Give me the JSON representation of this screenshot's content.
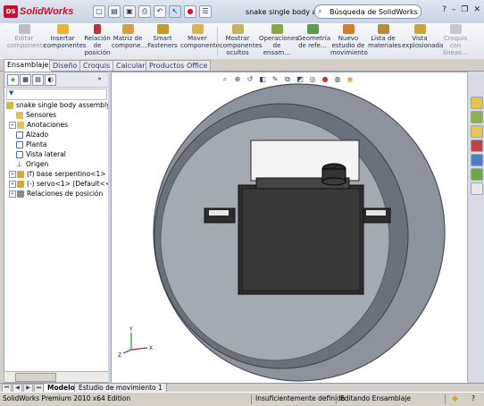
{
  "app": {
    "logo_letters": "DS",
    "name": "SolidWorks",
    "brand_color": "#c8102e"
  },
  "title": {
    "document": "snake single body asse…",
    "search_placeholder": "Búsqueda de SolidWorks",
    "help": "?"
  },
  "ribbon": {
    "buttons": [
      {
        "label": "Editar componente",
        "icon": "edit-component-icon",
        "disabled": true
      },
      {
        "label": "Insertar componentes",
        "icon": "insert-components-icon",
        "disabled": false
      },
      {
        "label": "Relación de posición",
        "icon": "mate-icon",
        "disabled": false
      },
      {
        "label": "Matriz de compone…",
        "icon": "component-pattern-icon",
        "disabled": false
      },
      {
        "label": "Smart Fasteners",
        "icon": "smart-fasteners-icon",
        "disabled": false
      },
      {
        "label": "Mover componente",
        "icon": "move-component-icon",
        "disabled": false
      },
      {
        "label": "Mostrar componentes ocultos",
        "icon": "show-hidden-icon",
        "disabled": false
      },
      {
        "label": "Operaciones de ensam…",
        "icon": "assembly-features-icon",
        "disabled": false
      },
      {
        "label": "Geometría de refe…",
        "icon": "reference-geometry-icon",
        "disabled": false
      },
      {
        "label": "Nuevo estudio de movimiento",
        "icon": "motion-study-icon",
        "disabled": false
      },
      {
        "label": "Lista de materiales",
        "icon": "bom-icon",
        "disabled": false
      },
      {
        "label": "Vista explosionada",
        "icon": "exploded-view-icon",
        "disabled": false
      },
      {
        "label": "Croquis con líneas…",
        "icon": "explode-line-sketch-icon",
        "disabled": true
      }
    ]
  },
  "command_tabs": [
    "Ensamblaje",
    "Diseño",
    "Croquis",
    "Calcular",
    "Productos Office"
  ],
  "command_tabs_active": 0,
  "feature_tree": {
    "root": "snake single body assembly (Pr…",
    "items": [
      {
        "label": "Sensores",
        "icon": "sensors-icon",
        "expand": ""
      },
      {
        "label": "Anotaciones",
        "icon": "annotations-icon",
        "expand": "+"
      },
      {
        "label": "Alzado",
        "icon": "front-plane-icon",
        "expand": ""
      },
      {
        "label": "Planta",
        "icon": "top-plane-icon",
        "expand": ""
      },
      {
        "label": "Vista lateral",
        "icon": "right-plane-icon",
        "expand": ""
      },
      {
        "label": "Origen",
        "icon": "origin-icon",
        "expand": ""
      },
      {
        "label": "(f) base serpentino<1> (Prec…",
        "icon": "part-icon",
        "expand": "+"
      },
      {
        "label": "(-) servo<1> (Default<<Defa…",
        "icon": "part-icon",
        "expand": "+"
      },
      {
        "label": "Relaciones de posición",
        "icon": "mates-folder-icon",
        "expand": "+"
      }
    ]
  },
  "bottom_tabs": [
    "Modelo",
    "Estudio de movimiento 1"
  ],
  "bottom_tabs_active": 0,
  "status": {
    "edition": "SolidWorks Premium 2010 x64 Edition",
    "definition": "Insuficientemente definida",
    "mode": "Editando Ensamblaje",
    "help": "?"
  },
  "triad": {
    "x": "X",
    "y": "Y",
    "z": "Z"
  },
  "colors": {
    "ring": "#848b95",
    "ring_inner": "#6f7680",
    "body": "#3a3a3a",
    "background": "#ffffff"
  }
}
